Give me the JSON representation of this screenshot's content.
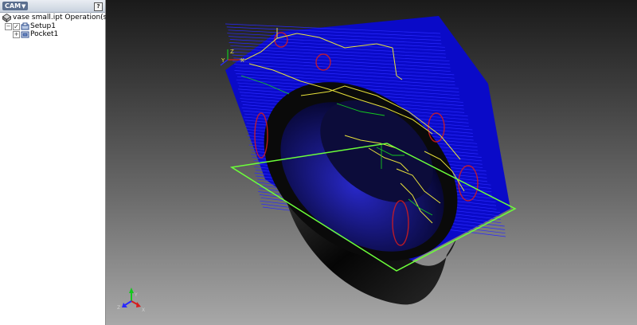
{
  "panel": {
    "title": "CAM",
    "help_label": "?",
    "tree": {
      "root_label": "vase small.ipt Operation(s)",
      "setup_label": "Setup1",
      "pocket_label": "Pocket1"
    }
  },
  "viewport": {
    "triad_small_labels": {
      "x": "X",
      "y": "Y",
      "z": "Z"
    },
    "triad_corner_labels": {
      "x": "X",
      "y": "Y",
      "z": "Z"
    }
  },
  "colors": {
    "toolpath": "#0a0adf",
    "rapid": "#e8e23a",
    "lead": "#14c81e",
    "plunge": "#d81c1c",
    "stock_box": "#6cff3a",
    "part": "#0a0a0a"
  }
}
